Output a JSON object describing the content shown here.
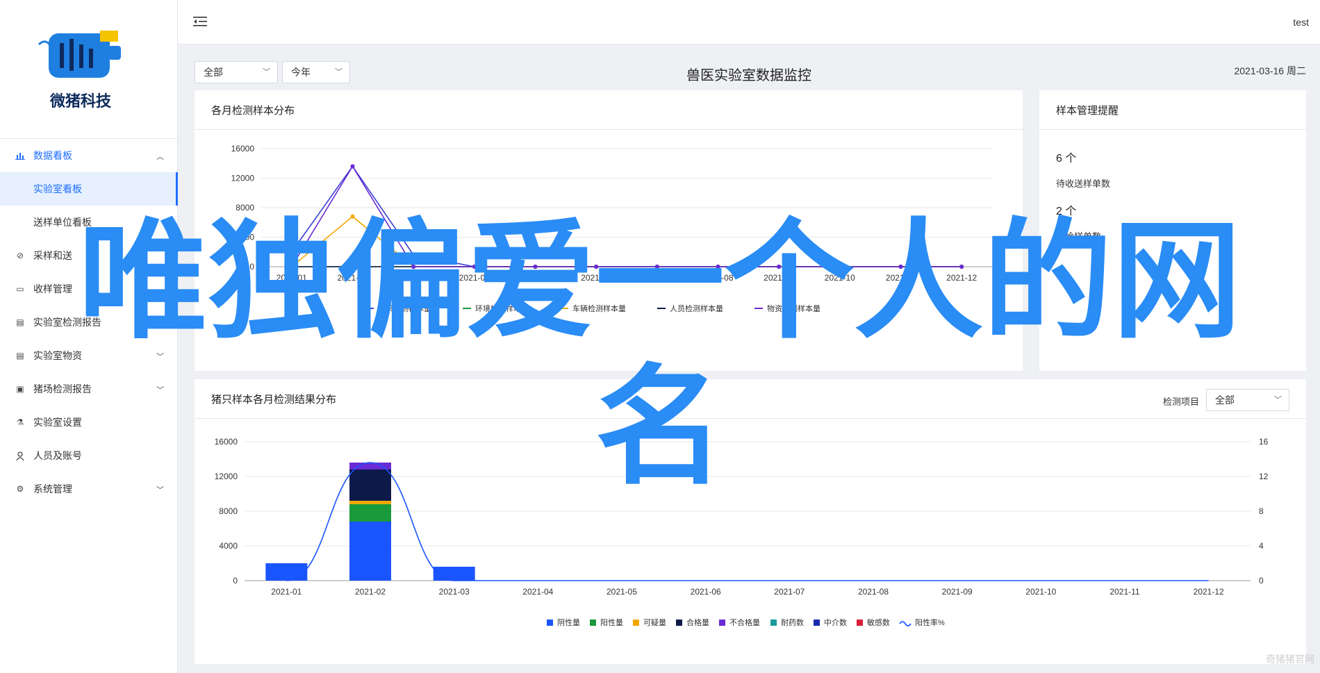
{
  "app": {
    "logo_text": "微猪科技",
    "user": "test"
  },
  "sidebar": {
    "items": [
      {
        "label": "数据看板",
        "icon": "bar-chart-icon",
        "active_parent": true,
        "expanded": true
      },
      {
        "label": "实验室看板",
        "sub": true,
        "active": true
      },
      {
        "label": "送样单位看板",
        "sub": true
      },
      {
        "label": "采样和送",
        "icon": "link-icon"
      },
      {
        "label": "收样管理",
        "icon": "inbox-icon"
      },
      {
        "label": "实验室检测报告",
        "icon": "document-icon"
      },
      {
        "label": "实验室物资",
        "icon": "clipboard-icon",
        "expandable": true
      },
      {
        "label": "猪场检测报告",
        "icon": "report-icon",
        "expandable": true
      },
      {
        "label": "实验室设置",
        "icon": "flask-icon"
      },
      {
        "label": "人员及账号",
        "icon": "user-icon"
      },
      {
        "label": "系统管理",
        "icon": "gear-icon",
        "expandable": true
      }
    ]
  },
  "filters": {
    "scope": "全部",
    "period": "今年"
  },
  "page": {
    "title": "兽医实验室数据监控",
    "date": "2021-03-16 周二"
  },
  "cards": {
    "monthly": {
      "title": "各月检测样本分布"
    },
    "reminder": {
      "title": "样本管理提醒",
      "items": [
        {
          "count": "6 个",
          "label": "待收送样单数"
        },
        {
          "count": "2 个",
          "label": "未检样单数"
        }
      ]
    },
    "results": {
      "title": "猪只样本各月检测结果分布",
      "filter_label": "检测项目",
      "filter_value": "全部"
    }
  },
  "chart_data": [
    {
      "type": "line",
      "categories": [
        "2021-01",
        "2021-02",
        "2021-03",
        "2021-04",
        "2021-05",
        "2021-06",
        "2021-07",
        "2021-08",
        "2021-09",
        "2021-10",
        "2021-11",
        "2021-12"
      ],
      "ylim": [
        0,
        16000
      ],
      "yticks": [
        "16000",
        "12000",
        "8000",
        "4000",
        "0"
      ],
      "series": [
        {
          "name": "猪只检测样本量",
          "color": "#3a3fd4",
          "values": [
            2000,
            13600,
            1600,
            0,
            0,
            0,
            0,
            0,
            0,
            0,
            0,
            0
          ]
        },
        {
          "name": "环境检测样本量",
          "color": "#1a9a3a",
          "values": [
            0,
            0,
            0,
            0,
            0,
            0,
            0,
            0,
            0,
            0,
            0,
            0
          ]
        },
        {
          "name": "车辆检测样本量",
          "color": "#f0a800",
          "values": [
            0,
            6800,
            0,
            0,
            0,
            0,
            0,
            0,
            0,
            0,
            0,
            0
          ]
        },
        {
          "name": "人员检测样本量",
          "color": "#0e1a4a",
          "values": [
            0,
            0,
            0,
            0,
            0,
            0,
            0,
            0,
            0,
            0,
            0,
            0
          ]
        },
        {
          "name": "物资检测样本量",
          "color": "#6a2bd6",
          "values": [
            0,
            13600,
            0,
            0,
            0,
            0,
            0,
            0,
            0,
            0,
            0,
            0
          ]
        }
      ]
    },
    {
      "type": "bar",
      "stacked": true,
      "categories": [
        "2021-01",
        "2021-02",
        "2021-03",
        "2021-04",
        "2021-05",
        "2021-06",
        "2021-07",
        "2021-08",
        "2021-09",
        "2021-10",
        "2021-11",
        "2021-12"
      ],
      "ylim": [
        0,
        16000
      ],
      "y2lim": [
        0,
        16
      ],
      "yticks": [
        "16000",
        "12000",
        "8000",
        "4000",
        "0"
      ],
      "y2ticks": [
        "16",
        "12",
        "8",
        "4",
        "0"
      ],
      "series": [
        {
          "name": "阴性量",
          "color": "#1a55ff",
          "values": [
            2000,
            6800,
            1600,
            0,
            0,
            0,
            0,
            0,
            0,
            0,
            0,
            0
          ]
        },
        {
          "name": "阳性量",
          "color": "#1a9a3a",
          "values": [
            0,
            2000,
            0,
            0,
            0,
            0,
            0,
            0,
            0,
            0,
            0,
            0
          ]
        },
        {
          "name": "可疑量",
          "color": "#f0a800",
          "values": [
            0,
            400,
            0,
            0,
            0,
            0,
            0,
            0,
            0,
            0,
            0,
            0
          ]
        },
        {
          "name": "合格量",
          "color": "#0e1a4a",
          "values": [
            0,
            3600,
            0,
            0,
            0,
            0,
            0,
            0,
            0,
            0,
            0,
            0
          ]
        },
        {
          "name": "不合格量",
          "color": "#6a2bd6",
          "values": [
            0,
            800,
            0,
            0,
            0,
            0,
            0,
            0,
            0,
            0,
            0,
            0
          ]
        },
        {
          "name": "耐药数",
          "color": "#1a9a9a",
          "values": [
            0,
            0,
            0,
            0,
            0,
            0,
            0,
            0,
            0,
            0,
            0,
            0
          ]
        },
        {
          "name": "中介数",
          "color": "#1a2ab0",
          "values": [
            0,
            0,
            0,
            0,
            0,
            0,
            0,
            0,
            0,
            0,
            0,
            0
          ]
        },
        {
          "name": "敏感数",
          "color": "#d6203a",
          "values": [
            0,
            0,
            0,
            0,
            0,
            0,
            0,
            0,
            0,
            0,
            0,
            0
          ]
        }
      ],
      "line_series": {
        "name": "阳性率%",
        "color": "#1a55ff",
        "values": [
          0,
          13.6,
          0,
          0,
          0,
          0,
          0,
          0,
          0,
          0,
          0,
          0
        ]
      }
    }
  ],
  "overlay": {
    "line1": "唯独偏爱一个人的网",
    "line2": "名",
    "corner": "奇猪猪官网"
  }
}
